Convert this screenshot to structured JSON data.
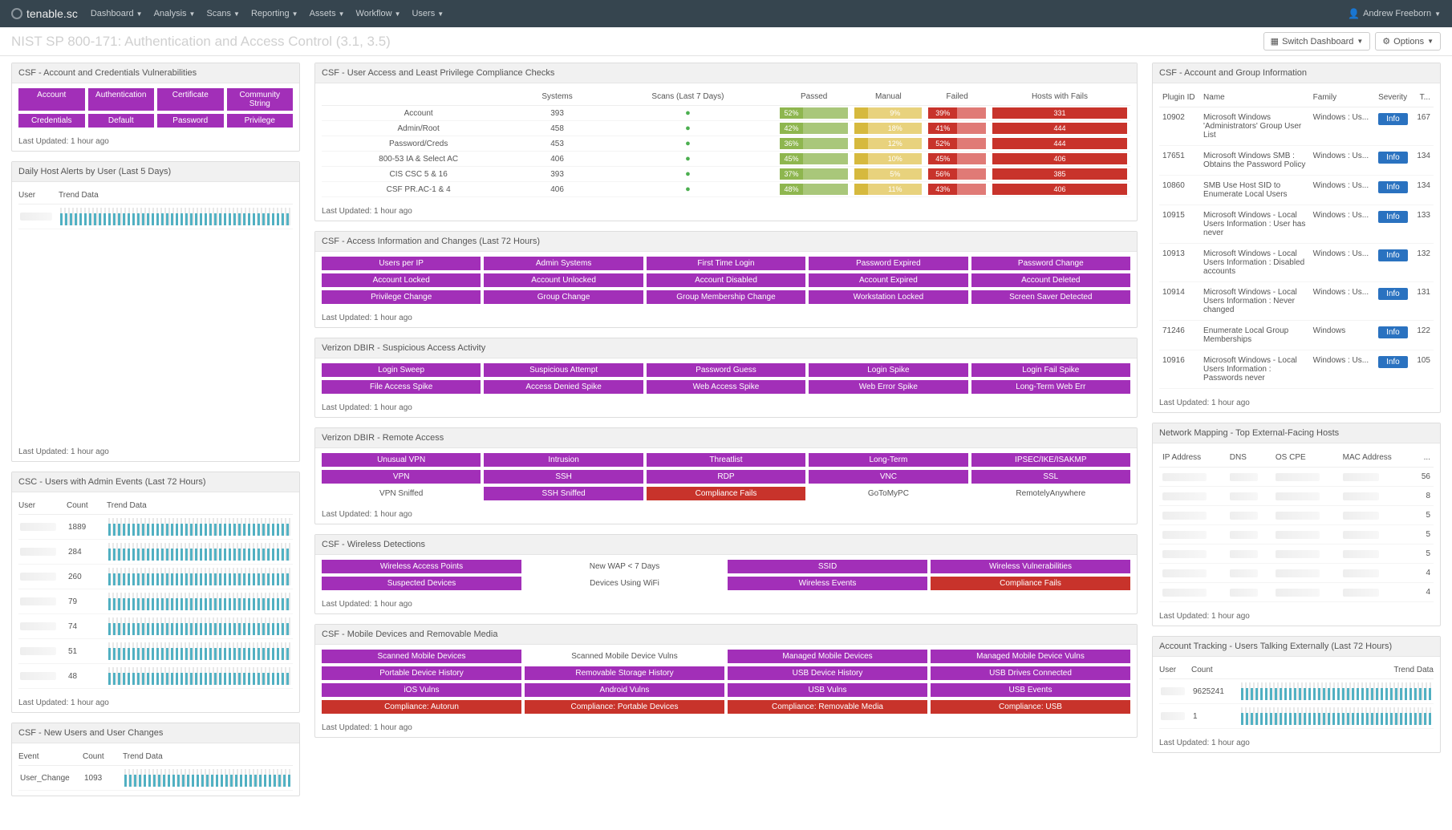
{
  "nav": {
    "brand": "tenable.sc",
    "items": [
      "Dashboard",
      "Analysis",
      "Scans",
      "Reporting",
      "Assets",
      "Workflow",
      "Users"
    ],
    "user": "Andrew Freeborn"
  },
  "page": {
    "title": "NIST SP 800-171: Authentication and Access Control (3.1, 3.5)",
    "switch_btn": "Switch Dashboard",
    "options_btn": "Options"
  },
  "updated": "Last Updated: 1 hour ago",
  "left": {
    "credvuln": {
      "title": "CSF - Account and Credentials Vulnerabilities",
      "rows": [
        [
          "Account",
          "Authentication",
          "Certificate",
          "Community String"
        ],
        [
          "Credentials",
          "Default",
          "Password",
          "Privilege"
        ]
      ]
    },
    "daily": {
      "title": "Daily Host Alerts by User (Last 5 Days)",
      "cols": [
        "User",
        "Trend Data"
      ]
    },
    "admin": {
      "title": "CSC - Users with Admin Events (Last 72 Hours)",
      "cols": [
        "User",
        "Count",
        "Trend Data"
      ],
      "rows": [
        {
          "count": "1889"
        },
        {
          "count": "284"
        },
        {
          "count": "260"
        },
        {
          "count": "79"
        },
        {
          "count": "74"
        },
        {
          "count": "51"
        },
        {
          "count": "48"
        }
      ]
    },
    "newusers": {
      "title": "CSF - New Users and User Changes",
      "cols": [
        "Event",
        "Count",
        "Trend Data"
      ],
      "rows": [
        {
          "event": "User_Change",
          "count": "1093"
        }
      ]
    }
  },
  "center": {
    "checks": {
      "title": "CSF - User Access and Least Privilege Compliance Checks",
      "cols": [
        "",
        "Systems",
        "Scans (Last 7 Days)",
        "Passed",
        "Manual",
        "Failed",
        "Hosts with Fails"
      ],
      "rows": [
        {
          "label": "Account",
          "systems": "393",
          "passed": "52%",
          "manual": "9%",
          "failed": "39%",
          "hosts": "331"
        },
        {
          "label": "Admin/Root",
          "systems": "458",
          "passed": "42%",
          "manual": "18%",
          "failed": "41%",
          "hosts": "444"
        },
        {
          "label": "Password/Creds",
          "systems": "453",
          "passed": "36%",
          "manual": "12%",
          "failed": "52%",
          "hosts": "444"
        },
        {
          "label": "800-53 IA & Select AC",
          "systems": "406",
          "passed": "45%",
          "manual": "10%",
          "failed": "45%",
          "hosts": "406"
        },
        {
          "label": "CIS CSC 5 & 16",
          "systems": "393",
          "passed": "37%",
          "manual": "5%",
          "failed": "56%",
          "hosts": "385"
        },
        {
          "label": "CSF PR.AC-1 & 4",
          "systems": "406",
          "passed": "48%",
          "manual": "11%",
          "failed": "43%",
          "hosts": "406"
        }
      ]
    },
    "access": {
      "title": "CSF - Access Information and Changes (Last 72 Hours)",
      "rows": [
        [
          "Users per IP",
          "Admin Systems",
          "First Time Login",
          "Password Expired",
          "Password Change"
        ],
        [
          "Account Locked",
          "Account Unlocked",
          "Account Disabled",
          "Account Expired",
          "Account Deleted"
        ],
        [
          "Privilege Change",
          "Group Change",
          "Group Membership Change",
          "Workstation Locked",
          "Screen Saver Detected"
        ]
      ]
    },
    "dbir": {
      "title": "Verizon DBIR - Suspicious Access Activity",
      "rows": [
        [
          "Login Sweep",
          "Suspicious Attempt",
          "Password Guess",
          "Login Spike",
          "Login Fail Spike"
        ],
        [
          "File Access Spike",
          "Access Denied Spike",
          "Web Access Spike",
          "Web Error Spike",
          "Long-Term Web Err"
        ]
      ]
    },
    "remote": {
      "title": "Verizon DBIR - Remote Access",
      "rows": [
        [
          {
            "t": "Unusual VPN",
            "c": "purple"
          },
          {
            "t": "Intrusion",
            "c": "purple"
          },
          {
            "t": "Threatlist",
            "c": "purple"
          },
          {
            "t": "Long-Term",
            "c": "purple"
          },
          {
            "t": "IPSEC/IKE/ISAKMP",
            "c": "purple"
          }
        ],
        [
          {
            "t": "VPN",
            "c": "purple"
          },
          {
            "t": "SSH",
            "c": "purple"
          },
          {
            "t": "RDP",
            "c": "purple"
          },
          {
            "t": "VNC",
            "c": "purple"
          },
          {
            "t": "SSL",
            "c": "purple"
          }
        ],
        [
          {
            "t": "VPN Sniffed",
            "c": "white"
          },
          {
            "t": "SSH Sniffed",
            "c": "purple"
          },
          {
            "t": "Compliance Fails",
            "c": "red"
          },
          {
            "t": "GoToMyPC",
            "c": "white"
          },
          {
            "t": "RemotelyAnywhere",
            "c": "white"
          }
        ]
      ]
    },
    "wireless": {
      "title": "CSF - Wireless Detections",
      "rows": [
        [
          {
            "t": "Wireless Access Points",
            "c": "purple"
          },
          {
            "t": "New WAP < 7 Days",
            "c": "white"
          },
          {
            "t": "SSID",
            "c": "purple"
          },
          {
            "t": "Wireless Vulnerabilities",
            "c": "purple"
          }
        ],
        [
          {
            "t": "Suspected Devices",
            "c": "purple"
          },
          {
            "t": "Devices Using WiFi",
            "c": "white"
          },
          {
            "t": "Wireless Events",
            "c": "purple"
          },
          {
            "t": "Compliance Fails",
            "c": "red"
          }
        ]
      ]
    },
    "mobile": {
      "title": "CSF - Mobile Devices and Removable Media",
      "rows": [
        [
          {
            "t": "Scanned Mobile Devices",
            "c": "purple"
          },
          {
            "t": "Scanned Mobile Device Vulns",
            "c": "white"
          },
          {
            "t": "Managed Mobile Devices",
            "c": "purple"
          },
          {
            "t": "Managed Mobile Device Vulns",
            "c": "purple"
          }
        ],
        [
          {
            "t": "Portable Device History",
            "c": "purple"
          },
          {
            "t": "Removable Storage History",
            "c": "purple"
          },
          {
            "t": "USB Device History",
            "c": "purple"
          },
          {
            "t": "USB Drives Connected",
            "c": "purple"
          }
        ],
        [
          {
            "t": "iOS Vulns",
            "c": "purple"
          },
          {
            "t": "Android Vulns",
            "c": "purple"
          },
          {
            "t": "USB Vulns",
            "c": "purple"
          },
          {
            "t": "USB Events",
            "c": "purple"
          }
        ],
        [
          {
            "t": "Compliance: Autorun",
            "c": "red"
          },
          {
            "t": "Compliance: Portable Devices",
            "c": "red"
          },
          {
            "t": "Compliance: Removable Media",
            "c": "red"
          },
          {
            "t": "Compliance: USB",
            "c": "red"
          }
        ]
      ]
    }
  },
  "right": {
    "acct": {
      "title": "CSF - Account and Group Information",
      "cols": [
        "Plugin ID",
        "Name",
        "Family",
        "Severity",
        "T..."
      ],
      "sev": "Info",
      "rows": [
        {
          "id": "10902",
          "name": "Microsoft Windows 'Administrators' Group User List",
          "fam": "Windows : Us...",
          "t": "167"
        },
        {
          "id": "17651",
          "name": "Microsoft Windows SMB : Obtains the Password Policy",
          "fam": "Windows : Us...",
          "t": "134"
        },
        {
          "id": "10860",
          "name": "SMB Use Host SID to Enumerate Local Users",
          "fam": "Windows : Us...",
          "t": "134"
        },
        {
          "id": "10915",
          "name": "Microsoft Windows - Local Users Information : User has never",
          "fam": "Windows : Us...",
          "t": "133"
        },
        {
          "id": "10913",
          "name": "Microsoft Windows - Local Users Information : Disabled accounts",
          "fam": "Windows : Us...",
          "t": "132"
        },
        {
          "id": "10914",
          "name": "Microsoft Windows - Local Users Information : Never changed",
          "fam": "Windows : Us...",
          "t": "131"
        },
        {
          "id": "71246",
          "name": "Enumerate Local Group Memberships",
          "fam": "Windows",
          "t": "122"
        },
        {
          "id": "10916",
          "name": "Microsoft Windows - Local Users Information : Passwords never",
          "fam": "Windows : Us...",
          "t": "105"
        }
      ]
    },
    "netmap": {
      "title": "Network Mapping - Top External-Facing Hosts",
      "cols": [
        "IP Address",
        "DNS",
        "OS CPE",
        "MAC Address",
        "..."
      ],
      "counts": [
        "56",
        "8",
        "5",
        "5",
        "5",
        "4",
        "4"
      ]
    },
    "track": {
      "title": "Account Tracking - Users Talking Externally (Last 72 Hours)",
      "cols": [
        "User",
        "Count",
        "Trend Data"
      ],
      "rows": [
        {
          "count": "9625241"
        },
        {
          "count": "1"
        }
      ]
    }
  }
}
